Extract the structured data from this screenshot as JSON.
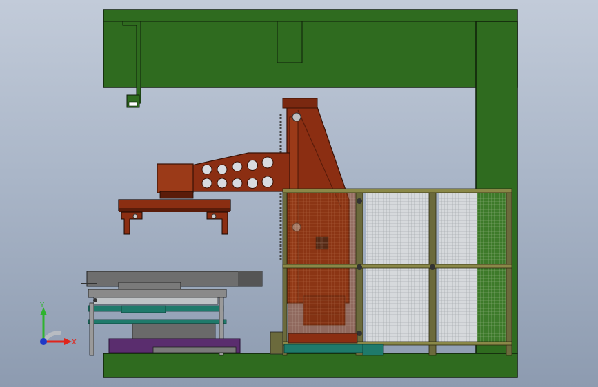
{
  "viewport": {
    "background_top": "#c2cbd9",
    "background_bottom": "#8d9bb0"
  },
  "model": {
    "colors": {
      "frame_green": "#2f6b1f",
      "frame_outline": "#0e1e08",
      "robot_brown": "#8b2e12",
      "robot_dark": "#5a1c0a",
      "fence_post": "#6b6a3c",
      "mesh": "#cfd3d6",
      "conveyor_gray": "#6e6e6e",
      "teal": "#1f7a6b",
      "purple": "#5a2d6e"
    }
  },
  "triad": {
    "x_label": "X",
    "y_label": "Y",
    "x_color": "#e0241b",
    "y_color": "#2fb32f",
    "z_color": "#1e38c8",
    "icon": "coordinate-triad-icon"
  }
}
